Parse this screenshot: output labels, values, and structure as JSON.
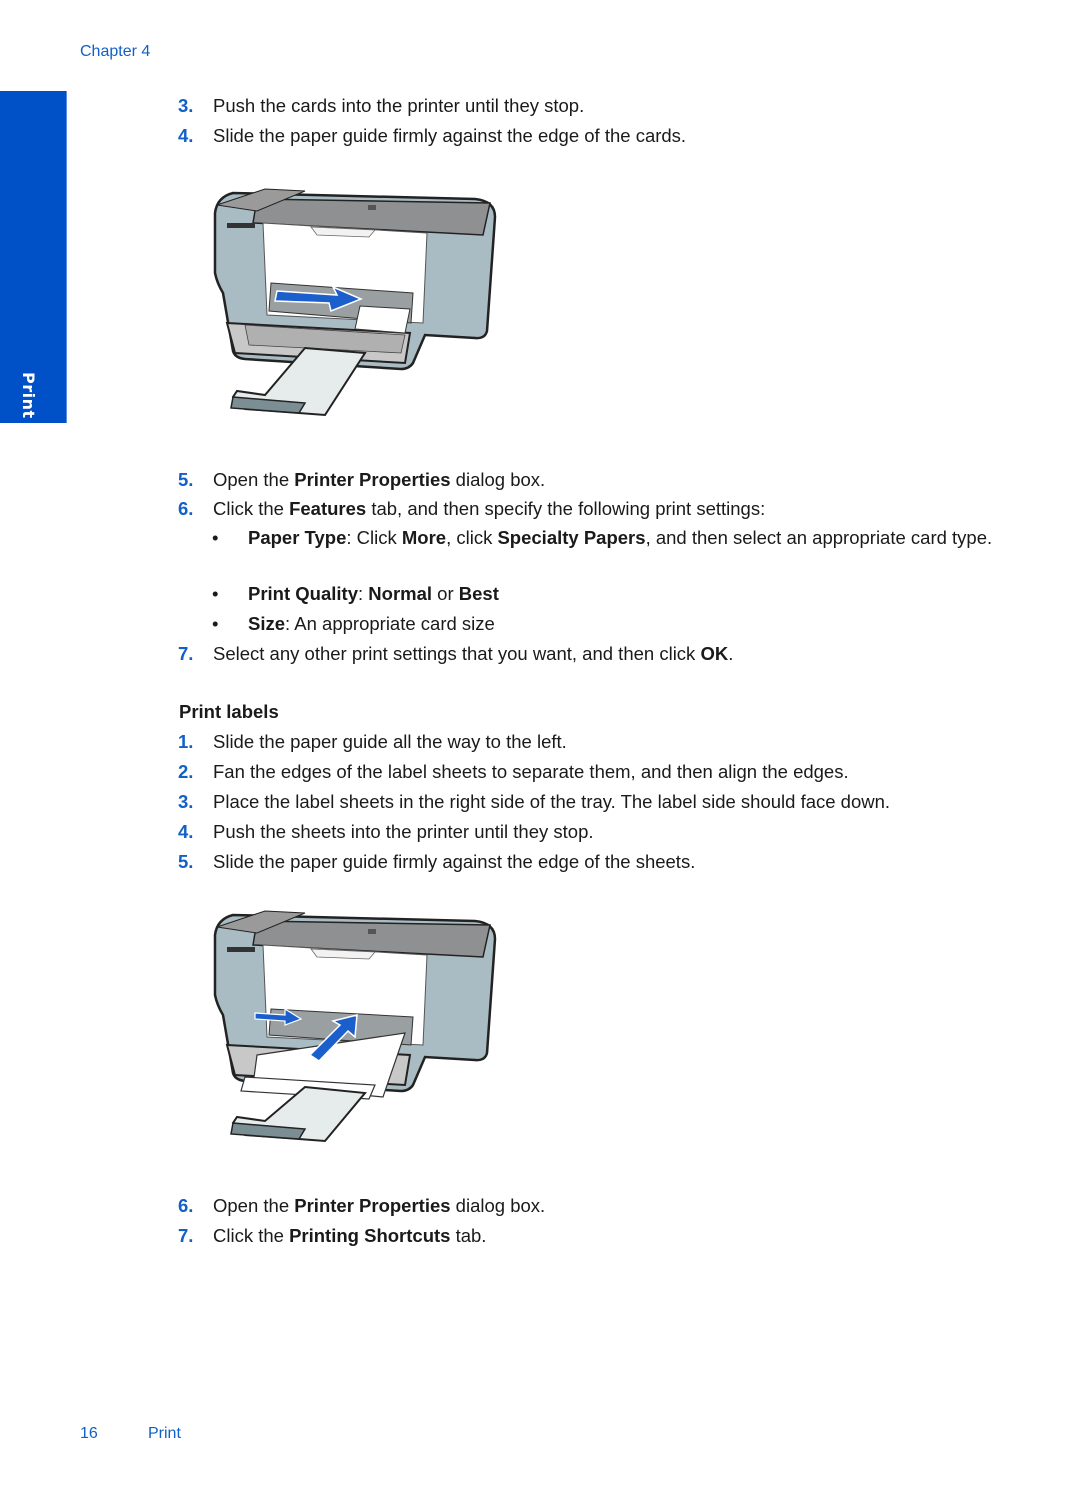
{
  "header": {
    "chapter": "Chapter 4"
  },
  "side_tab": {
    "label": "Print",
    "color": "#0050c8"
  },
  "cards_steps_top": [
    {
      "num": "3.",
      "text": "Push the cards into the printer until they stop."
    },
    {
      "num": "4.",
      "text": "Slide the paper guide firmly against the edge of the cards."
    }
  ],
  "figure1": {
    "description": "printer-illustration-card-loading",
    "arrow": "horizontal-right"
  },
  "cards_steps_bottom": {
    "step5": {
      "num": "5.",
      "pre": "Open the ",
      "bold": "Printer Properties",
      "post": " dialog box."
    },
    "step6": {
      "num": "6.",
      "pre": "Click the ",
      "bold": "Features",
      "post": " tab, and then specify the following print settings:"
    },
    "bullets": {
      "paper_type": {
        "b1": "Paper Type",
        "t1": ": Click ",
        "b2": "More",
        "t2": ", click ",
        "b3": "Specialty Papers",
        "t3": ", and then select an appropriate card type."
      },
      "print_quality": {
        "b1": "Print Quality",
        "t1": ": ",
        "b2": "Normal",
        "t2": " or ",
        "b3": "Best"
      },
      "size": {
        "b1": "Size",
        "t1": ": An appropriate card size"
      }
    },
    "step7": {
      "num": "7.",
      "pre": "Select any other print settings that you want, and then click ",
      "bold": "OK",
      "post": "."
    }
  },
  "labels_section": {
    "heading": "Print labels",
    "steps": [
      {
        "num": "1.",
        "text": "Slide the paper guide all the way to the left."
      },
      {
        "num": "2.",
        "text": "Fan the edges of the label sheets to separate them, and then align the edges."
      },
      {
        "num": "3.",
        "text": "Place the label sheets in the right side of the tray. The label side should face down."
      },
      {
        "num": "4.",
        "text": "Push the sheets into the printer until they stop."
      },
      {
        "num": "5.",
        "text": "Slide the paper guide firmly against the edge of the sheets."
      }
    ],
    "step6": {
      "num": "6.",
      "pre": "Open the ",
      "bold": "Printer Properties",
      "post": " dialog box."
    },
    "step7": {
      "num": "7.",
      "pre": "Click the ",
      "bold": "Printing Shortcuts",
      "post": " tab."
    }
  },
  "figure2": {
    "description": "printer-illustration-label-loading",
    "arrows": [
      "horizontal-right",
      "diagonal-up"
    ]
  },
  "footer": {
    "page_number": "16",
    "section": "Print"
  },
  "colors": {
    "accent": "#1060c8",
    "arrow_blue": "#1a5fcc",
    "printer_body": "#a9bcc4",
    "printer_gray": "#8f8f8f"
  }
}
